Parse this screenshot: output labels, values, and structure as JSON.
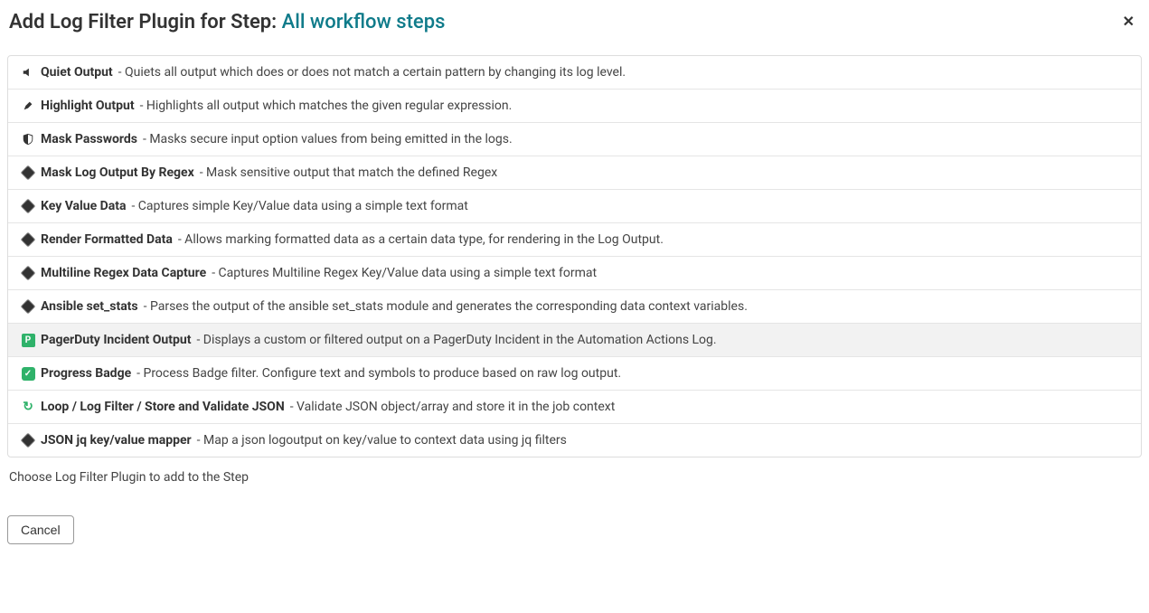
{
  "header": {
    "title_prefix": "Add Log Filter Plugin for Step: ",
    "title_link": "All workflow steps",
    "close": "✕"
  },
  "items": [
    {
      "icon": "mute-icon",
      "name": "Quiet Output",
      "desc": " - Quiets all output which does or does not match a certain pattern by changing its log level."
    },
    {
      "icon": "highlighter-icon",
      "name": "Highlight Output",
      "desc": " - Highlights all output which matches the given regular expression."
    },
    {
      "icon": "shield-icon",
      "name": "Mask Passwords",
      "desc": " - Masks secure input option values from being emitted in the logs."
    },
    {
      "icon": "diamond-icon",
      "name": "Mask Log Output By Regex",
      "desc": " - Mask sensitive output that match the defined Regex"
    },
    {
      "icon": "diamond-icon",
      "name": "Key Value Data",
      "desc": " - Captures simple Key/Value data using a simple text format"
    },
    {
      "icon": "diamond-icon",
      "name": "Render Formatted Data",
      "desc": " - Allows marking formatted data as a certain data type, for rendering in the Log Output."
    },
    {
      "icon": "diamond-icon",
      "name": "Multiline Regex Data Capture",
      "desc": " - Captures Multiline Regex Key/Value data using a simple text format"
    },
    {
      "icon": "diamond-icon",
      "name": "Ansible set_stats",
      "desc": " - Parses the output of the ansible set_stats module and generates the corresponding data context variables."
    },
    {
      "icon": "pagerduty-icon",
      "name": "PagerDuty Incident Output",
      "desc": " - Displays a custom or filtered output on a PagerDuty Incident in the Automation Actions Log.",
      "hover": true
    },
    {
      "icon": "check-badge-icon",
      "name": "Progress Badge",
      "desc": " - Process Badge filter. Configure text and symbols to produce based on raw log output."
    },
    {
      "icon": "loop-icon",
      "name": "Loop / Log Filter / Store and Validate JSON",
      "desc": " - Validate JSON object/array and store it in the job context"
    },
    {
      "icon": "diamond-icon",
      "name": "JSON jq key/value mapper",
      "desc": " - Map a json logoutput on key/value to context data using jq filters"
    }
  ],
  "help": "Choose Log Filter Plugin to add to the Step",
  "footer": {
    "cancel": "Cancel"
  }
}
